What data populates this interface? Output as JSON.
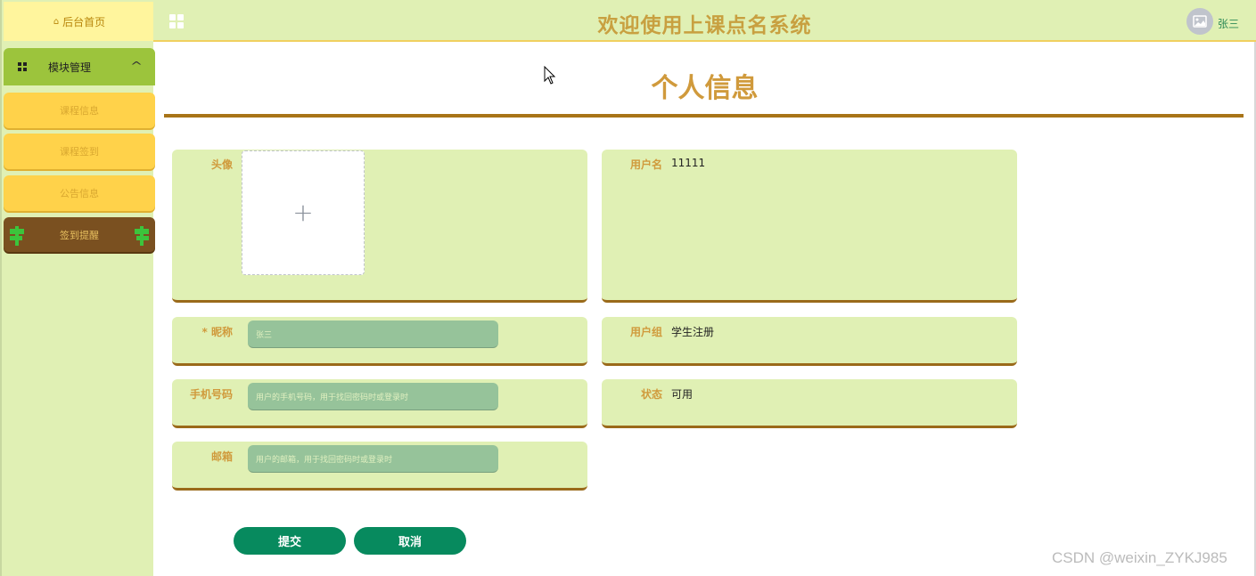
{
  "sidebar": {
    "home_label": "后台首页",
    "module_label": "模块管理",
    "sub_items": [
      {
        "label": "课程信息"
      },
      {
        "label": "课程签到"
      },
      {
        "label": "公告信息"
      }
    ],
    "sign_reminder_label": "签到提醒"
  },
  "header": {
    "title": "欢迎使用上课点名系统",
    "user_name": "张三"
  },
  "main": {
    "page_title": "个人信息",
    "fields": {
      "avatar": {
        "label": "头像"
      },
      "username": {
        "label": "用户名",
        "value": "11111"
      },
      "nickname": {
        "label": "* 昵称",
        "value": "张三"
      },
      "user_group": {
        "label": "用户组",
        "value": "学生注册"
      },
      "phone": {
        "label": "手机号码",
        "placeholder": "用户的手机号码，用于找回密码时或登录时"
      },
      "status": {
        "label": "状态",
        "value": "可用"
      },
      "email": {
        "label": "邮箱",
        "placeholder": "用户的邮箱，用于找回密码时或登录时"
      }
    },
    "submit_label": "提交",
    "cancel_label": "取消"
  },
  "watermark": "CSDN @weixin_ZYKJ985",
  "colors": {
    "sidebar_bg": "#e0f0b4",
    "module_bg": "#9cc43c",
    "submenu_bg": "#ffd24a",
    "sign_bg": "#7a5020",
    "title_color": "#d09a3c",
    "button_bg": "#078a5e",
    "input_bg": "#96c39a"
  }
}
